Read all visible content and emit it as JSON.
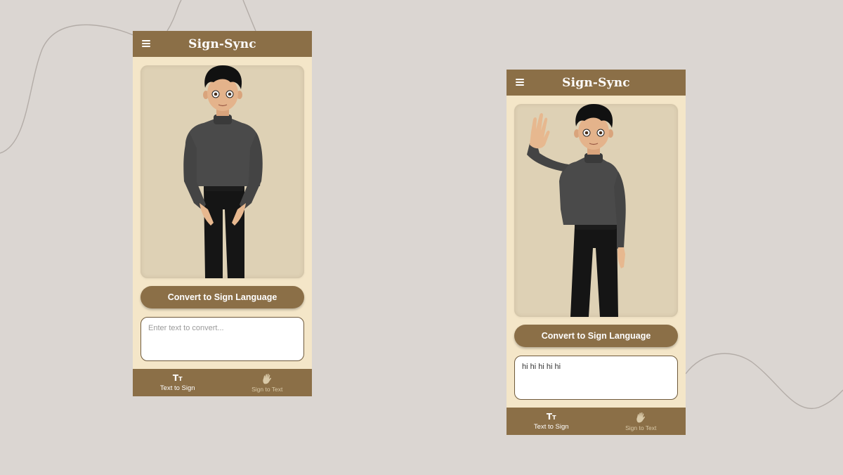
{
  "app": {
    "title": "Sign-Sync"
  },
  "theme": {
    "background": "#dbd6d2",
    "phone_background": "#f4e6c8",
    "primary": "#8b6f47",
    "card": "#ded1b5"
  },
  "screens": [
    {
      "title": "Sign-Sync",
      "avatar_pose": "idle",
      "convert_label": "Convert to Sign Language",
      "input": {
        "value": "",
        "placeholder": "Enter text to convert..."
      },
      "nav": [
        {
          "label": "Text to Sign",
          "icon": "text-size-icon",
          "active": true
        },
        {
          "label": "Sign to Text",
          "icon": "waving-hand-icon",
          "active": false
        }
      ]
    },
    {
      "title": "Sign-Sync",
      "avatar_pose": "waving",
      "convert_label": "Convert to Sign Language",
      "input": {
        "value": "hi hi hi hi hi",
        "placeholder": "Enter text to convert..."
      },
      "nav": [
        {
          "label": "Text to Sign",
          "icon": "text-size-icon",
          "active": true
        },
        {
          "label": "Sign to Text",
          "icon": "waving-hand-icon",
          "active": false
        }
      ]
    }
  ]
}
